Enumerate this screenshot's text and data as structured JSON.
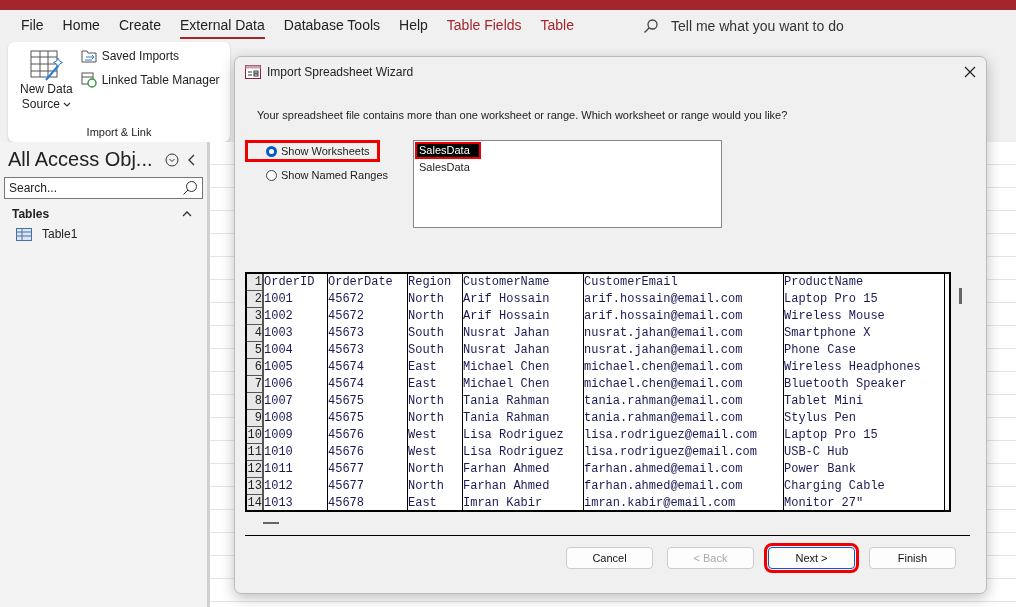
{
  "menu": [
    {
      "label": "File",
      "selected": false,
      "contextual": false
    },
    {
      "label": "Home",
      "selected": false,
      "contextual": false
    },
    {
      "label": "Create",
      "selected": false,
      "contextual": false
    },
    {
      "label": "External Data",
      "selected": true,
      "contextual": false
    },
    {
      "label": "Database Tools",
      "selected": false,
      "contextual": false
    },
    {
      "label": "Help",
      "selected": false,
      "contextual": false
    },
    {
      "label": "Table Fields",
      "selected": false,
      "contextual": true
    },
    {
      "label": "Table",
      "selected": false,
      "contextual": true
    }
  ],
  "tell_me": {
    "placeholder": "Tell me what you want to do"
  },
  "ribbon": {
    "new_data_source": [
      "New Data",
      "Source"
    ],
    "saved_imports": "Saved Imports",
    "linked_table_manager": "Linked Table Manager",
    "group_label": "Import & Link"
  },
  "nav_pane": {
    "title": "All Access Obj...",
    "search": {
      "placeholder": "Search..."
    },
    "section": {
      "label": "Tables",
      "expanded": true,
      "items": [
        "Table1"
      ]
    }
  },
  "dialog": {
    "title": "Import Spreadsheet Wizard",
    "prompt": "Your spreadsheet file contains more than one worksheet or range. Which worksheet or range would you like?",
    "options": [
      {
        "label": "Show Worksheets",
        "selected": true,
        "highlighted": true
      },
      {
        "label": "Show Named Ranges",
        "selected": false,
        "highlighted": false
      }
    ],
    "sheets": [
      {
        "label": "SalesData",
        "selected": true,
        "highlighted": true
      },
      {
        "label": "SalesData",
        "selected": false,
        "highlighted": false
      }
    ],
    "preview": {
      "rows": [
        {
          "num": "1",
          "cells": [
            "OrderID",
            "OrderDate",
            "Region",
            "CustomerName",
            "CustomerEmail",
            "ProductName"
          ]
        },
        {
          "num": "2",
          "cells": [
            "1001",
            "45672",
            "North",
            "Arif Hossain",
            "arif.hossain@email.com",
            "Laptop Pro 15"
          ]
        },
        {
          "num": "3",
          "cells": [
            "1002",
            "45672",
            "North",
            "Arif Hossain",
            "arif.hossain@email.com",
            "Wireless Mouse"
          ]
        },
        {
          "num": "4",
          "cells": [
            "1003",
            "45673",
            "South",
            "Nusrat Jahan",
            "nusrat.jahan@email.com",
            "Smartphone X"
          ]
        },
        {
          "num": "5",
          "cells": [
            "1004",
            "45673",
            "South",
            "Nusrat Jahan",
            "nusrat.jahan@email.com",
            "Phone Case"
          ]
        },
        {
          "num": "6",
          "cells": [
            "1005",
            "45674",
            "East",
            "Michael Chen",
            "michael.chen@email.com",
            "Wireless Headphones"
          ]
        },
        {
          "num": "7",
          "cells": [
            "1006",
            "45674",
            "East",
            "Michael Chen",
            "michael.chen@email.com",
            "Bluetooth Speaker"
          ]
        },
        {
          "num": "8",
          "cells": [
            "1007",
            "45675",
            "North",
            "Tania Rahman",
            "tania.rahman@email.com",
            "Tablet Mini"
          ]
        },
        {
          "num": "9",
          "cells": [
            "1008",
            "45675",
            "North",
            "Tania Rahman",
            "tania.rahman@email.com",
            "Stylus Pen"
          ]
        },
        {
          "num": "10",
          "cells": [
            "1009",
            "45676",
            "West",
            "Lisa Rodriguez",
            "lisa.rodriguez@email.com",
            "Laptop Pro 15"
          ]
        },
        {
          "num": "11",
          "cells": [
            "1010",
            "45676",
            "West",
            "Lisa Rodriguez",
            "lisa.rodriguez@email.com",
            "USB-C Hub"
          ]
        },
        {
          "num": "12",
          "cells": [
            "1011",
            "45677",
            "North",
            "Farhan Ahmed",
            "farhan.ahmed@email.com",
            "Power Bank"
          ]
        },
        {
          "num": "13",
          "cells": [
            "1012",
            "45677",
            "North",
            "Farhan Ahmed",
            "farhan.ahmed@email.com",
            "Charging Cable"
          ]
        },
        {
          "num": "14",
          "cells": [
            "1013",
            "45678",
            "East",
            "Imran Kabir",
            "imran.kabir@email.com",
            "Monitor 27\""
          ]
        }
      ]
    },
    "buttons": [
      {
        "label": "Cancel",
        "disabled": false,
        "default": false,
        "highlighted": false
      },
      {
        "label": "< Back",
        "disabled": true,
        "default": false,
        "highlighted": false
      },
      {
        "label": "Next >",
        "disabled": false,
        "default": true,
        "highlighted": true
      },
      {
        "label": "Finish",
        "disabled": false,
        "default": false,
        "highlighted": false
      }
    ]
  }
}
